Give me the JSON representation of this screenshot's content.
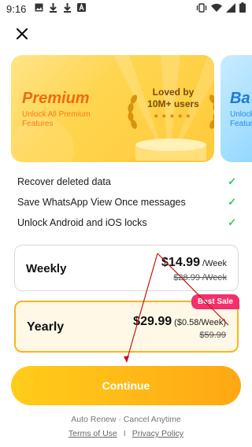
{
  "status_bar": {
    "time": "9:16",
    "icons_left": [
      "image-icon",
      "download-icon",
      "download-icon",
      "font-icon"
    ],
    "icons_right": [
      "vibrate-icon",
      "wifi-icon",
      "signal-icon",
      "battery-icon"
    ]
  },
  "cards": {
    "premium": {
      "title": "Premium",
      "subtitle": "Unlock All Premium Features",
      "badge_line1": "Loved by",
      "badge_line2": "10M+ users",
      "stars": "★★★★★"
    },
    "basic": {
      "title": "Ba",
      "subtitle": "Unlock Feature"
    }
  },
  "features": [
    {
      "label": "Recover deleted data"
    },
    {
      "label": "Save WhatsApp View Once messages"
    },
    {
      "label": "Unlock Android and iOS locks"
    }
  ],
  "plans": {
    "weekly": {
      "name": "Weekly",
      "price": "$14.99",
      "period": " /Week",
      "original": "$28.99 /Week"
    },
    "yearly": {
      "name": "Yearly",
      "badge": "Best Sale",
      "price": "$29.99",
      "period": " ($0.58/Week)",
      "original": "$59.99",
      "selected": true
    }
  },
  "continue_label": "Continue",
  "footer": {
    "note": "Auto Renew · Cancel Anytime",
    "terms": "Terms of Use",
    "separator": "I",
    "privacy": "Privacy Policy"
  },
  "colors": {
    "accent_orange": "#ffa714",
    "accent_yellow": "#ffcd1a",
    "premium_title": "#f06a12",
    "check_green": "#35c96b",
    "badge_pink": "#f52f6d"
  }
}
